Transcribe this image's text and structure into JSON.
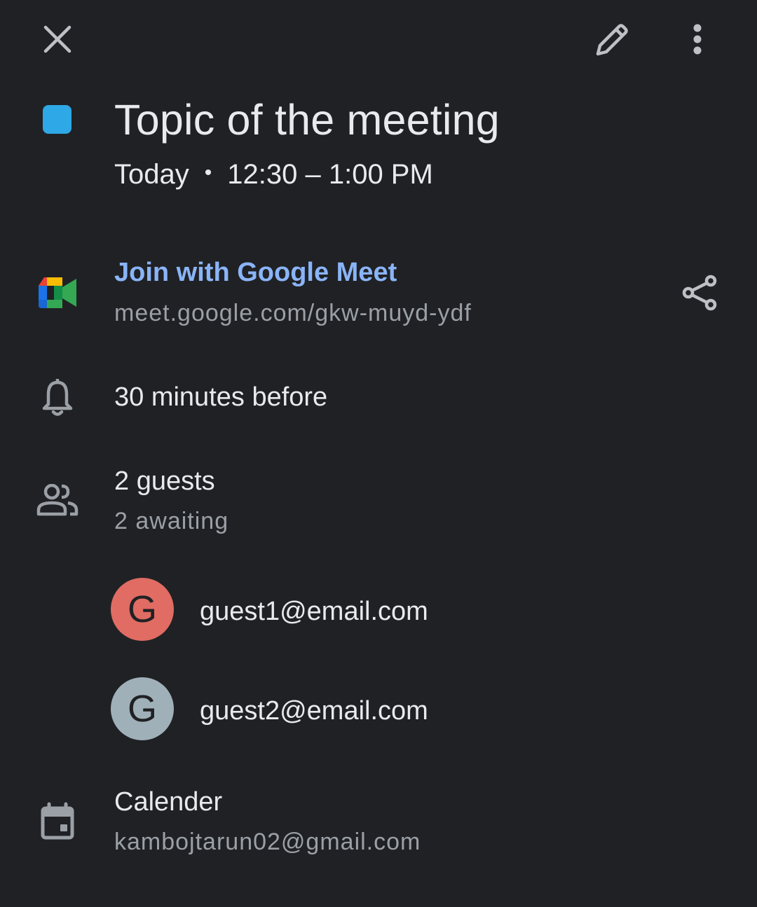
{
  "toolbar": {
    "close_icon": "close-icon",
    "edit_icon": "pencil-icon",
    "more_icon": "more-vert-icon"
  },
  "event": {
    "color": "#2ea8e6",
    "title": "Topic of the meeting",
    "day": "Today",
    "separator": "•",
    "time": "12:30 – 1:00 PM"
  },
  "meet": {
    "join_label": "Join with Google Meet",
    "link": "meet.google.com/gkw-muyd-ydf",
    "link_color": "#8ab4f8"
  },
  "reminder": {
    "text": "30 minutes before"
  },
  "guests": {
    "count_label": "2 guests",
    "status_label": "2 awaiting",
    "list": [
      {
        "initial": "G",
        "email": "guest1@email.com",
        "avatar_color": "#e06c63"
      },
      {
        "initial": "G",
        "email": "guest2@email.com",
        "avatar_color": "#9fb0b9"
      }
    ]
  },
  "calendar": {
    "label": "Calender",
    "account": "kambojtarun02@gmail.com"
  },
  "colors": {
    "background": "#202124",
    "primary_text": "#e8eaed",
    "secondary_text": "#9aa0a6",
    "icon": "#9aa0a6"
  }
}
